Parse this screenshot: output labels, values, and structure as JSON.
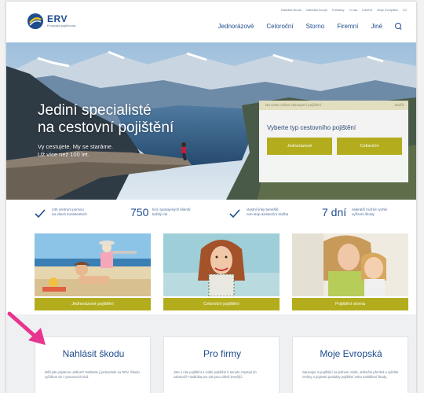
{
  "logo": {
    "name": "ERV",
    "tagline": "Evropská pojišťovna"
  },
  "util_nav": [
    "Nahlásit škodu",
    "Nabídka koupě",
    "Kontakty",
    "O nás",
    "Kariéra",
    "Moje Evropská",
    "CZ"
  ],
  "main_nav": [
    "Jednorázové",
    "Celoroční",
    "Storno",
    "Firemní",
    "Jiné"
  ],
  "hero": {
    "title_line1": "Jediní specialisté",
    "title_line2": "na cestovní pojištění",
    "sub_line1": "Vy cestujete. My se staráme.",
    "sub_line2": "Už více než 100 let."
  },
  "quick": {
    "head": "Na cestu online zakoupení pojištění",
    "close": "Zavřít",
    "question": "Vyberte typ cestovního pojištění",
    "btn1": "Jednorázové",
    "btn2": "Celoroční"
  },
  "stats": {
    "s1": [
      "24h centrum pomoci",
      "na všech kontinentech"
    ],
    "s2_num": "750",
    "s2": [
      "tisíc spokojených klientů",
      "každý rok"
    ],
    "s3": [
      "vlastní linky benefitů",
      "non-stop asistenční služba"
    ],
    "s4_num": "7 dní",
    "s4": [
      "nejkratší možné rychlé",
      "vyřízení škody"
    ]
  },
  "cards": [
    {
      "label": "Jednorázové pojištění"
    },
    {
      "label": "Celoroční pojištění"
    },
    {
      "label": "Pojištění storna"
    }
  ],
  "bottom": [
    {
      "title": "Nahlásit škodu",
      "text": "Měli jste pojistnou událost? Nahlaste ji jednoduše na ERV. Škodu vyřídíme do 7 pracovních dnů."
    },
    {
      "title": "Pro firmy",
      "text": "Jste u nás pojištění a volíte pojištění k tomuto chystají do zahraničí? Nabídka pro vás jsou citlivě levnější."
    },
    {
      "title": "Moje Evropská",
      "text": "Spravujte si pojištění na jednom místě, stáhněte přehled a vyřešte změny a pojistné produkty pojištění nebo nahlášení škody."
    }
  ],
  "colors": {
    "accent": "#b3ad1d",
    "brand": "#1f4c8f",
    "arrow": "#e8368f"
  }
}
